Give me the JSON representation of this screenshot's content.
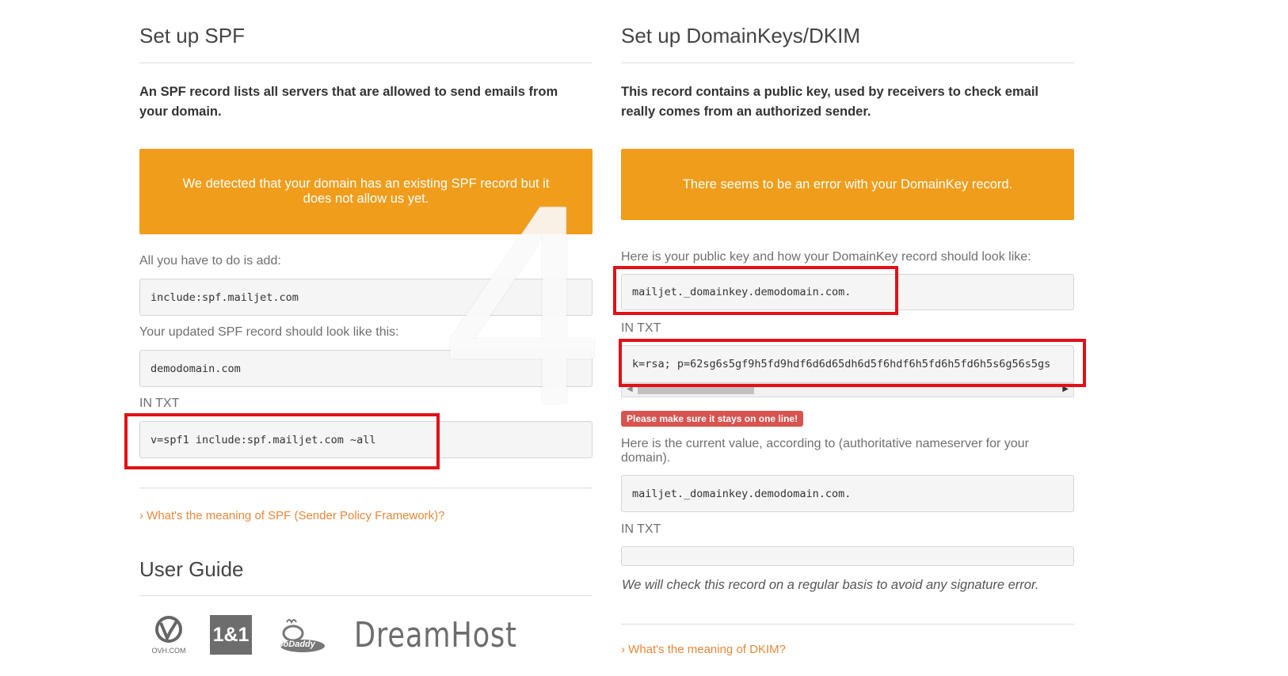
{
  "spf": {
    "title": "Set up SPF",
    "intro": "An SPF record lists all servers that are allowed to send emails from your domain.",
    "banner": "We detected that your domain has an existing SPF record but it does not allow us yet.",
    "add_label": "All you have to do is add:",
    "add_value": "include:spf.mailjet.com",
    "updated_label": "Your updated SPF record should look like this:",
    "host_value": "demodomain.com",
    "in_txt_label": "IN TXT",
    "txt_value": "v=spf1 include:spf.mailjet.com ~all",
    "meaning_link": "What's the meaning of SPF (Sender Policy Framework)?"
  },
  "user_guide": {
    "title": "User Guide",
    "providers": [
      "OVH.COM",
      "1&1",
      "GoDaddy",
      "DreamHost"
    ]
  },
  "dkim": {
    "title": "Set up DomainKeys/DKIM",
    "intro": "This record contains a public key, used by receivers to check email really comes from an authorized sender.",
    "banner": "There seems to be an error with your DomainKey record.",
    "pubkey_label": "Here is your public key and how your DomainKey record should look like:",
    "host_value": "mailjet._domainkey.demodomain.com.",
    "in_txt_label": "IN TXT",
    "txt_value": "k=rsa; p=62sg6s5gf9h5fd9hdf6d6d65dh6d5f6hdf6h5fd6h5fd6h5s6g56s5gs",
    "one_line_badge": "Please make sure it stays on one line!",
    "current_label": "Here is the current value, according to (authoritative nameserver for your domain).",
    "current_host_value": "mailjet._domainkey.demodomain.com.",
    "current_in_txt_label": "IN TXT",
    "current_txt_value": "",
    "check_note": "We will check this record on a regular basis to avoid any signature error.",
    "meaning_link": "What's the meaning of DKIM?"
  },
  "step_watermark": "4",
  "colors": {
    "banner": "#f09d1b",
    "highlight": "#e31017",
    "link": "#e8883a",
    "badge": "#d9534f"
  }
}
